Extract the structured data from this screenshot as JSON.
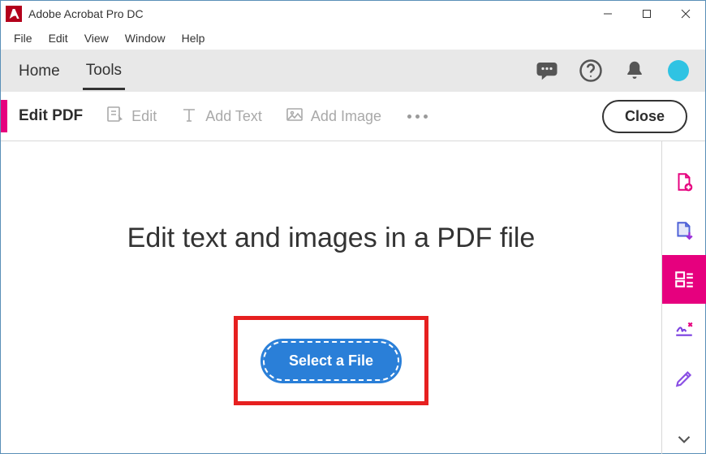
{
  "window": {
    "title": "Adobe Acrobat Pro DC"
  },
  "menubar": {
    "items": [
      "File",
      "Edit",
      "View",
      "Window",
      "Help"
    ]
  },
  "tabs": {
    "home": "Home",
    "tools": "Tools"
  },
  "toolbar": {
    "section_label": "Edit PDF",
    "edit_label": "Edit",
    "add_text_label": "Add Text",
    "add_image_label": "Add Image",
    "close_label": "Close"
  },
  "content": {
    "headline": "Edit text and images in a PDF file",
    "select_file_label": "Select a File"
  },
  "rail": {
    "items": [
      "create-pdf",
      "export-pdf",
      "organize-pages",
      "sign",
      "edit"
    ]
  }
}
